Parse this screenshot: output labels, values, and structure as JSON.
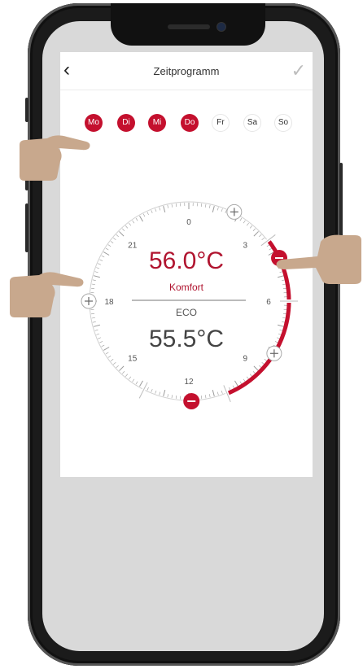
{
  "header": {
    "title": "Zeitprogramm",
    "back_icon": "chevron-left-icon",
    "confirm_icon": "check-icon"
  },
  "days": [
    {
      "label": "Mo",
      "active": true
    },
    {
      "label": "Di",
      "active": true
    },
    {
      "label": "Mi",
      "active": true
    },
    {
      "label": "Do",
      "active": true
    },
    {
      "label": "Fr",
      "active": false
    },
    {
      "label": "Sa",
      "active": false
    },
    {
      "label": "So",
      "active": false
    }
  ],
  "dial": {
    "hour_labels": [
      "0",
      "3",
      "6",
      "9",
      "12",
      "15",
      "18",
      "21"
    ],
    "comfort_temp": "56.0°C",
    "comfort_label": "Komfort",
    "eco_label": "ECO",
    "eco_temp": "55.5°C",
    "comfort_range_hours": [
      3.5,
      10.5
    ]
  },
  "colors": {
    "accent": "#c4102e",
    "text": "#333333",
    "screen_bg": "#d9d9d9"
  }
}
